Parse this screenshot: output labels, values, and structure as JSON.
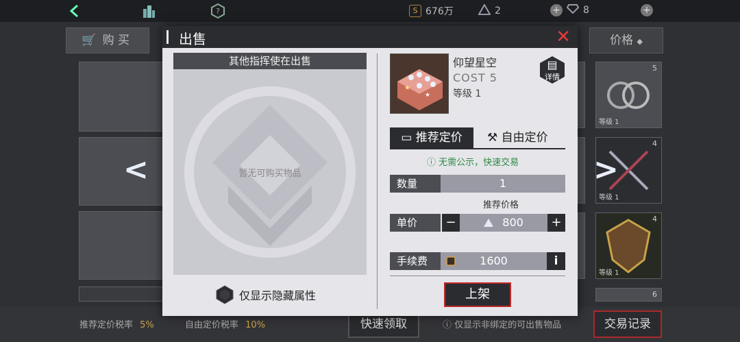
{
  "topbar": {
    "back_icon": "chevron-left-icon",
    "city_icon": "city-icon",
    "help_icon": "question-icon",
    "gold_amount": "676万",
    "crystal_amount": "2",
    "gem_amount": "8"
  },
  "background": {
    "buy_tab": "购 买",
    "sort_label": "价格",
    "card_level": "等级 1",
    "card_counts": [
      "5",
      "4",
      "4",
      "6"
    ],
    "recommend_tax_label": "推荐定价税率",
    "recommend_tax_value": "5%",
    "free_tax_label": "自由定价税率",
    "free_tax_value": "10%",
    "quick_claim_button": "快速领取",
    "unbound_note": "仅显示非绑定的可出售物品",
    "trade_record_button": "交易记录"
  },
  "modal": {
    "title": "出售",
    "left_panel_title": "其他指挥使在出售",
    "empty_text": "暂无可购买物品",
    "hidden_attr_label": "仅显示隐藏属性",
    "item": {
      "name": "仰望星空",
      "cost": "COST 5",
      "level": "等级 1",
      "detail_label": "详情"
    },
    "tabs": {
      "recommend": "推荐定价",
      "free": "自由定价"
    },
    "notice": "无需公示，快速交易",
    "quantity_label": "数量",
    "quantity_value": "1",
    "recommend_price_label": "推荐价格",
    "unit_price_label": "单价",
    "unit_price_value": "800",
    "fee_label": "手续费",
    "fee_value": "1600",
    "list_button": "上架"
  },
  "colors": {
    "accent_red": "#c02a2a",
    "notice_green": "#2f8a46",
    "dark_panel": "#2b2c30"
  }
}
